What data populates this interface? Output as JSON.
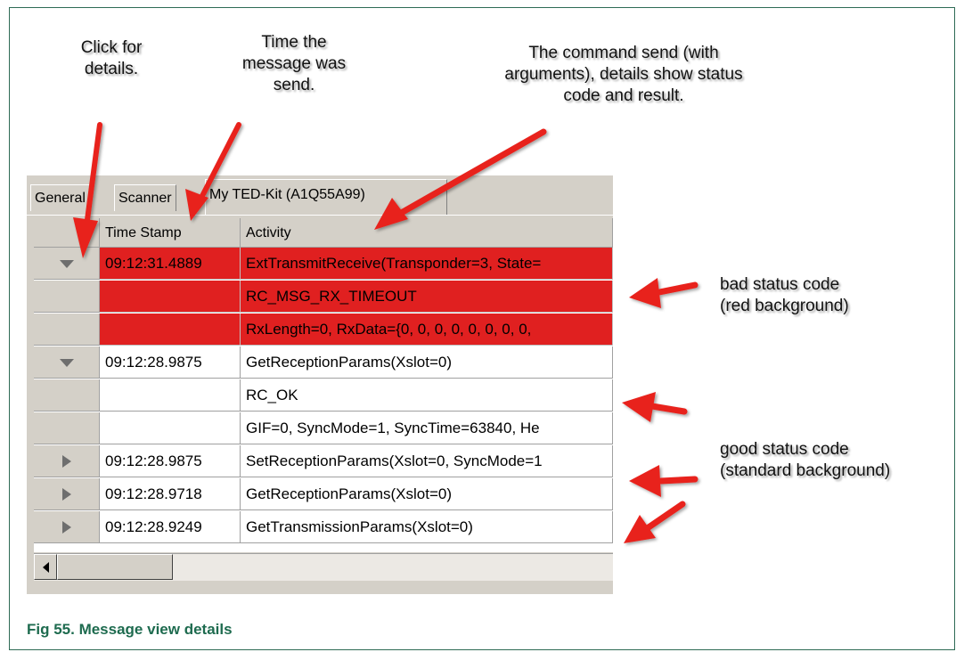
{
  "callouts": {
    "click": "Click for\ndetails.",
    "time": "Time the\nmessage was\nsend.",
    "command": "The command send (with\narguments), details show status\ncode and result.",
    "bad": "bad status code\n(red background)",
    "good": "good status code\n(standard background)"
  },
  "tabs": [
    "General",
    "Scanner",
    "My TED-Kit (A1Q55A99)"
  ],
  "columns": [
    "Time Stamp",
    "Activity"
  ],
  "rows": [
    {
      "time": "09:12:31.4889",
      "activity": "ExtTransmitReceive(Transponder=3, State=",
      "expander": "expanded",
      "status": "bad"
    },
    {
      "time": "",
      "activity": "RC_MSG_RX_TIMEOUT",
      "expander": "none",
      "status": "bad"
    },
    {
      "time": "",
      "activity": "RxLength=0, RxData={0, 0, 0, 0, 0, 0, 0, 0,",
      "expander": "none",
      "status": "bad"
    },
    {
      "time": "09:12:28.9875",
      "activity": "GetReceptionParams(Xslot=0)",
      "expander": "expanded",
      "status": "good"
    },
    {
      "time": "",
      "activity": "RC_OK",
      "expander": "none",
      "status": "good"
    },
    {
      "time": "",
      "activity": "GIF=0, SyncMode=1, SyncTime=63840, He",
      "expander": "none",
      "status": "good"
    },
    {
      "time": "09:12:28.9875",
      "activity": "SetReceptionParams(Xslot=0, SyncMode=1",
      "expander": "collapsed",
      "status": "good"
    },
    {
      "time": "09:12:28.9718",
      "activity": "GetReceptionParams(Xslot=0)",
      "expander": "collapsed",
      "status": "good"
    },
    {
      "time": "09:12:28.9249",
      "activity": "GetTransmissionParams(Xslot=0)",
      "expander": "collapsed",
      "status": "good"
    }
  ],
  "caption": "Fig 55.   Message view details",
  "colors": {
    "bad_background": "#e02020",
    "arrow": "#e8231e",
    "caption": "#1e6b4f"
  },
  "icons": [
    "expand-down-icon",
    "expand-right-icon",
    "scroll-left-icon"
  ]
}
